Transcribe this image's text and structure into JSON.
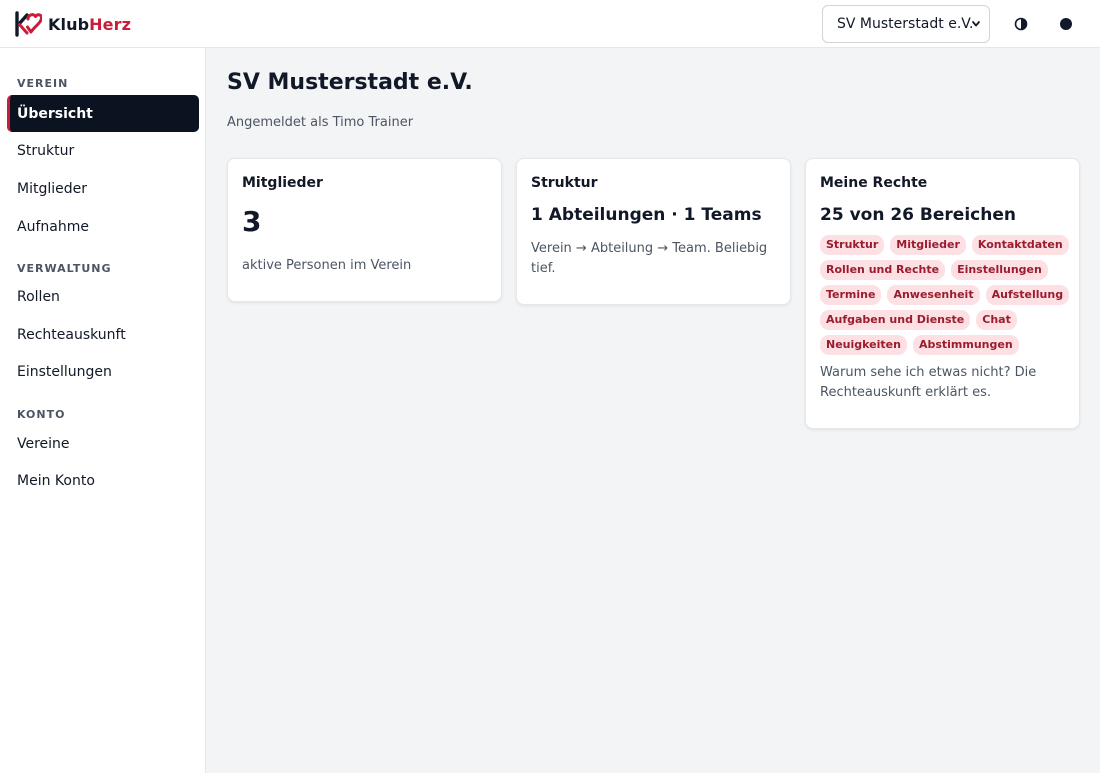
{
  "header": {
    "logo_part1": "Klub",
    "logo_part2": "Herz",
    "club_select_value": "SV Musterstadt e.V.",
    "contrast_icon": "contrast-icon",
    "theme_icon": "circle-icon"
  },
  "colors": {
    "brand": "#c81e3a",
    "active_nav_bg": "#0b1220",
    "tag_bg": "#fde0e3",
    "tag_text": "#9b1c2e"
  },
  "sidebar": {
    "sections": [
      {
        "title": "VEREIN",
        "items": [
          "Übersicht",
          "Struktur",
          "Mitglieder",
          "Aufnahme"
        ]
      },
      {
        "title": "VERWALTUNG",
        "items": [
          "Rollen",
          "Rechteauskunft",
          "Einstellungen"
        ]
      },
      {
        "title": "KONTO",
        "items": [
          "Vereine",
          "Mein Konto"
        ]
      }
    ],
    "active_item": "Übersicht"
  },
  "main": {
    "title": "SV Musterstadt e.V.",
    "subtitle": "Angemeldet als Timo Trainer",
    "cards": {
      "members": {
        "title": "Mitglieder",
        "value": "3",
        "text": "aktive Personen im Verein"
      },
      "structure": {
        "title": "Struktur",
        "headline": "1 Abteilungen · 1 Teams",
        "text": "Verein → Abteilung → Team. Beliebig tief."
      },
      "rights": {
        "title": "Meine Rechte",
        "headline": "25 von 26 Bereichen",
        "tags": [
          "Struktur",
          "Mitglieder",
          "Kontaktdaten",
          "Rollen und Rechte",
          "Einstellungen",
          "Termine",
          "Anwesenheit",
          "Aufstellung",
          "Aufgaben und Dienste",
          "Chat",
          "Neuigkeiten",
          "Abstimmungen"
        ],
        "text": "Warum sehe ich etwas nicht? Die Rechteauskunft erklärt es."
      }
    }
  }
}
